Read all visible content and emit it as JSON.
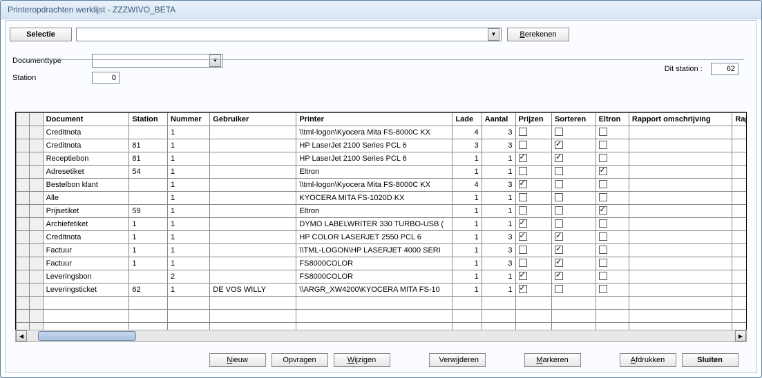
{
  "window_title": "Printeropdrachten werklijst   -   ZZZWIVO_BETA",
  "toolbar": {
    "selectie_label": "Selectie",
    "berekenen_label": "Berekenen"
  },
  "filters": {
    "documenttype_label": "Documenttype",
    "station_label": "Station",
    "station_value": "0",
    "dit_station_label": "Dit station :",
    "dit_station_value": "62"
  },
  "columns": [
    "Document",
    "Station",
    "Nummer",
    "Gebruiker",
    "Printer",
    "Lade",
    "Aantal",
    "Prijzen",
    "Sorteren",
    "Eltron",
    "Rapport omschrijving",
    "Rapportna"
  ],
  "rows": [
    {
      "document": "Creditnota",
      "station": "",
      "nummer": "1",
      "gebruiker": "",
      "printer": "\\\\tml-logon\\Kyocera Mita FS-8000C KX",
      "lade": "4",
      "aantal": "3",
      "prijzen": false,
      "sorteren": false,
      "eltron": false,
      "rapport": ""
    },
    {
      "document": "Creditnota",
      "station": "81",
      "nummer": "1",
      "gebruiker": "",
      "printer": "HP LaserJet 2100 Series PCL 6",
      "lade": "3",
      "aantal": "3",
      "prijzen": false,
      "sorteren": true,
      "eltron": false,
      "rapport": ""
    },
    {
      "document": "Receptiebon",
      "station": "81",
      "nummer": "1",
      "gebruiker": "",
      "printer": "HP LaserJet 2100 Series PCL 6",
      "lade": "1",
      "aantal": "1",
      "prijzen": true,
      "sorteren": true,
      "eltron": false,
      "rapport": ""
    },
    {
      "document": "Adresetiket",
      "station": "54",
      "nummer": "1",
      "gebruiker": "",
      "printer": "Eltron",
      "lade": "1",
      "aantal": "1",
      "prijzen": false,
      "sorteren": false,
      "eltron": true,
      "rapport": ""
    },
    {
      "document": "Bestelbon klant",
      "station": "",
      "nummer": "1",
      "gebruiker": "",
      "printer": "\\\\tml-logon\\Kyocera Mita FS-8000C KX",
      "lade": "4",
      "aantal": "3",
      "prijzen": true,
      "sorteren": false,
      "eltron": false,
      "rapport": ""
    },
    {
      "document": "Alle",
      "station": "",
      "nummer": "1",
      "gebruiker": "",
      "printer": "KYOCERA MITA FS-1020D KX",
      "lade": "1",
      "aantal": "1",
      "prijzen": false,
      "sorteren": false,
      "eltron": false,
      "rapport": ""
    },
    {
      "document": "Prijsetiket",
      "station": "59",
      "nummer": "1",
      "gebruiker": "",
      "printer": "Eltron",
      "lade": "1",
      "aantal": "1",
      "prijzen": false,
      "sorteren": false,
      "eltron": true,
      "rapport": ""
    },
    {
      "document": "Archiefetiket",
      "station": "1",
      "nummer": "1",
      "gebruiker": "",
      "printer": "DYMO LABELWRITER 330 TURBO-USB (",
      "lade": "1",
      "aantal": "1",
      "prijzen": true,
      "sorteren": false,
      "eltron": false,
      "rapport": ""
    },
    {
      "document": "Creditnota",
      "station": "1",
      "nummer": "1",
      "gebruiker": "",
      "printer": "HP COLOR LASERJET 2550 PCL 6",
      "lade": "1",
      "aantal": "3",
      "prijzen": true,
      "sorteren": true,
      "eltron": false,
      "rapport": ""
    },
    {
      "document": "Factuur",
      "station": "1",
      "nummer": "1",
      "gebruiker": "",
      "printer": "\\\\TML-LOGON\\HP LASERJET 4000 SERI",
      "lade": "1",
      "aantal": "3",
      "prijzen": false,
      "sorteren": true,
      "eltron": false,
      "rapport": ""
    },
    {
      "document": "Factuur",
      "station": "1",
      "nummer": "1",
      "gebruiker": "",
      "printer": "FS8000COLOR",
      "lade": "1",
      "aantal": "3",
      "prijzen": false,
      "sorteren": true,
      "eltron": false,
      "rapport": ""
    },
    {
      "document": "Leveringsbon",
      "station": "",
      "nummer": "2",
      "gebruiker": "",
      "printer": "FS8000COLOR",
      "lade": "1",
      "aantal": "1",
      "prijzen": true,
      "sorteren": true,
      "eltron": false,
      "rapport": ""
    },
    {
      "document": "Leveringsticket",
      "station": "62",
      "nummer": "1",
      "gebruiker": "DE VOS WILLY",
      "printer": "\\\\ARGR_XW4200\\KYOCERA MITA FS-10",
      "lade": "1",
      "aantal": "1",
      "prijzen": true,
      "sorteren": false,
      "eltron": false,
      "rapport": ""
    }
  ],
  "empty_rows": 5,
  "footer": {
    "nieuw": "Nieuw",
    "opvragen": "Opvragen",
    "wijzigen": "Wijzigen",
    "verwijderen": "Verwijderen",
    "markeren": "Markeren",
    "afdrukken": "Afdrukken",
    "sluiten": "Sluiten"
  }
}
